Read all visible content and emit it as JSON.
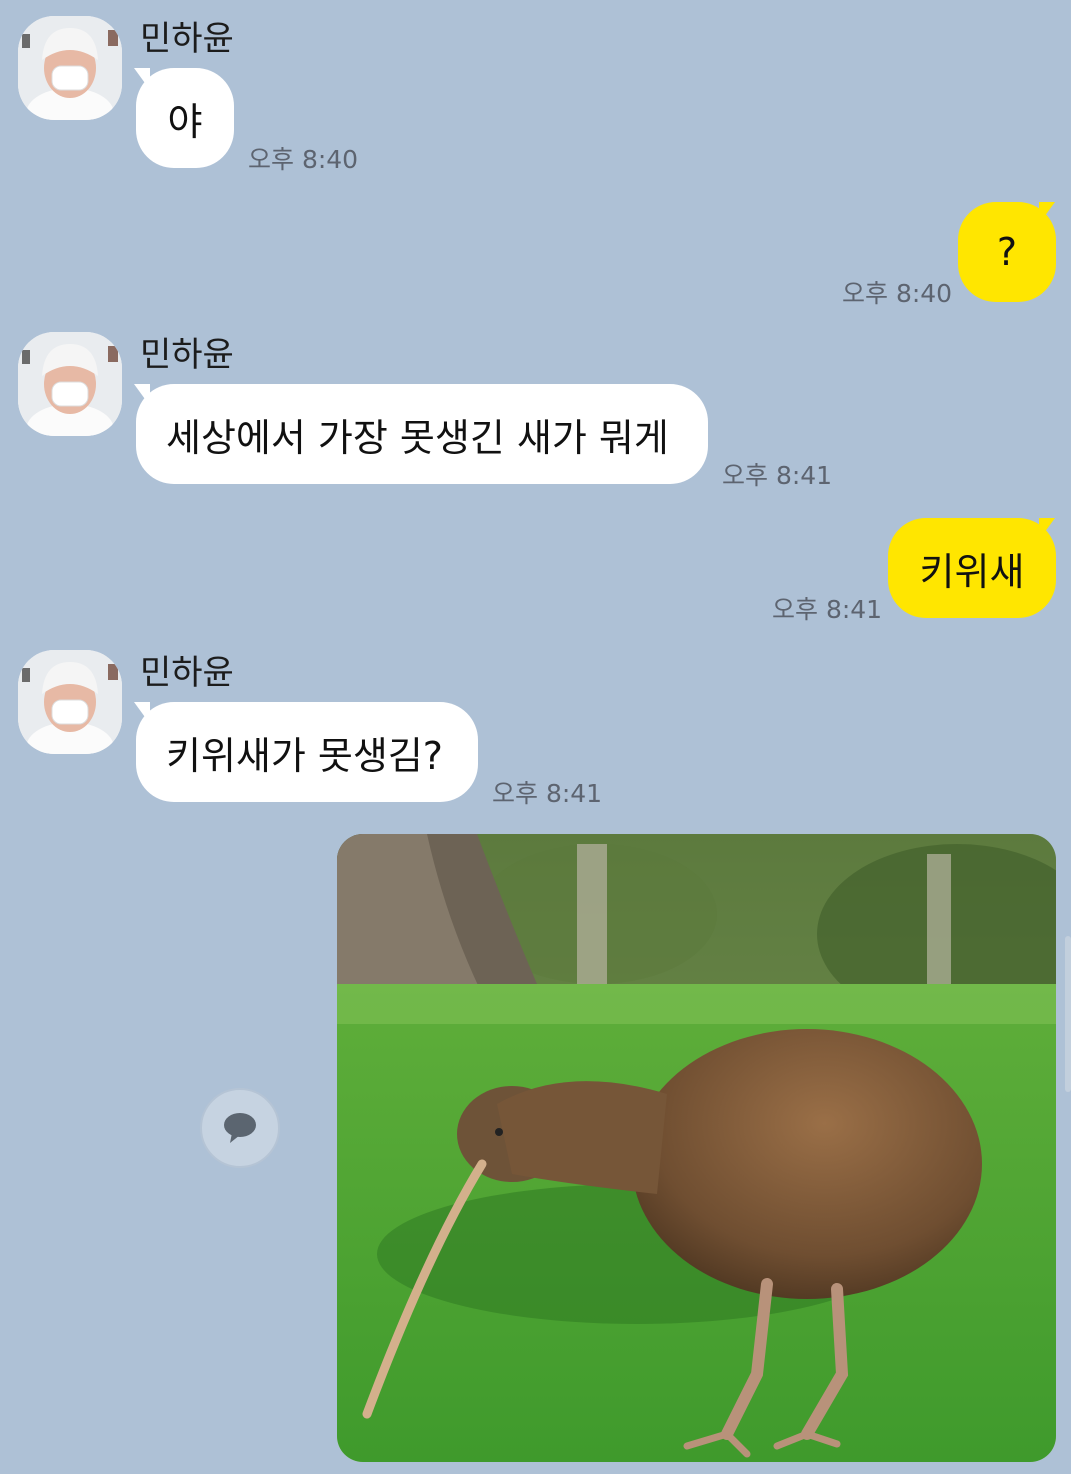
{
  "chat": {
    "sender_name": "민하윤",
    "messages": [
      {
        "from": "other",
        "text": "야",
        "time": "오후 8:40"
      },
      {
        "from": "me",
        "text": "?",
        "time": "오후 8:40"
      },
      {
        "from": "other",
        "text": "세상에서 가장 못생긴 새가 뭐게",
        "time": "오후 8:41"
      },
      {
        "from": "me",
        "text": "키위새",
        "time": "오후 8:41"
      },
      {
        "from": "other",
        "text": "키위새가 못생김?",
        "time": "오후 8:41"
      },
      {
        "from": "me",
        "type": "image",
        "subject": "kiwi-bird-photo"
      }
    ]
  },
  "colors": {
    "background": "#aec1d6",
    "incoming_bubble": "#ffffff",
    "outgoing_bubble": "#ffe600",
    "timestamp": "#5d6470"
  },
  "icons": {
    "reply_button": "speech-bubble-icon",
    "avatar": "profile-avatar"
  }
}
